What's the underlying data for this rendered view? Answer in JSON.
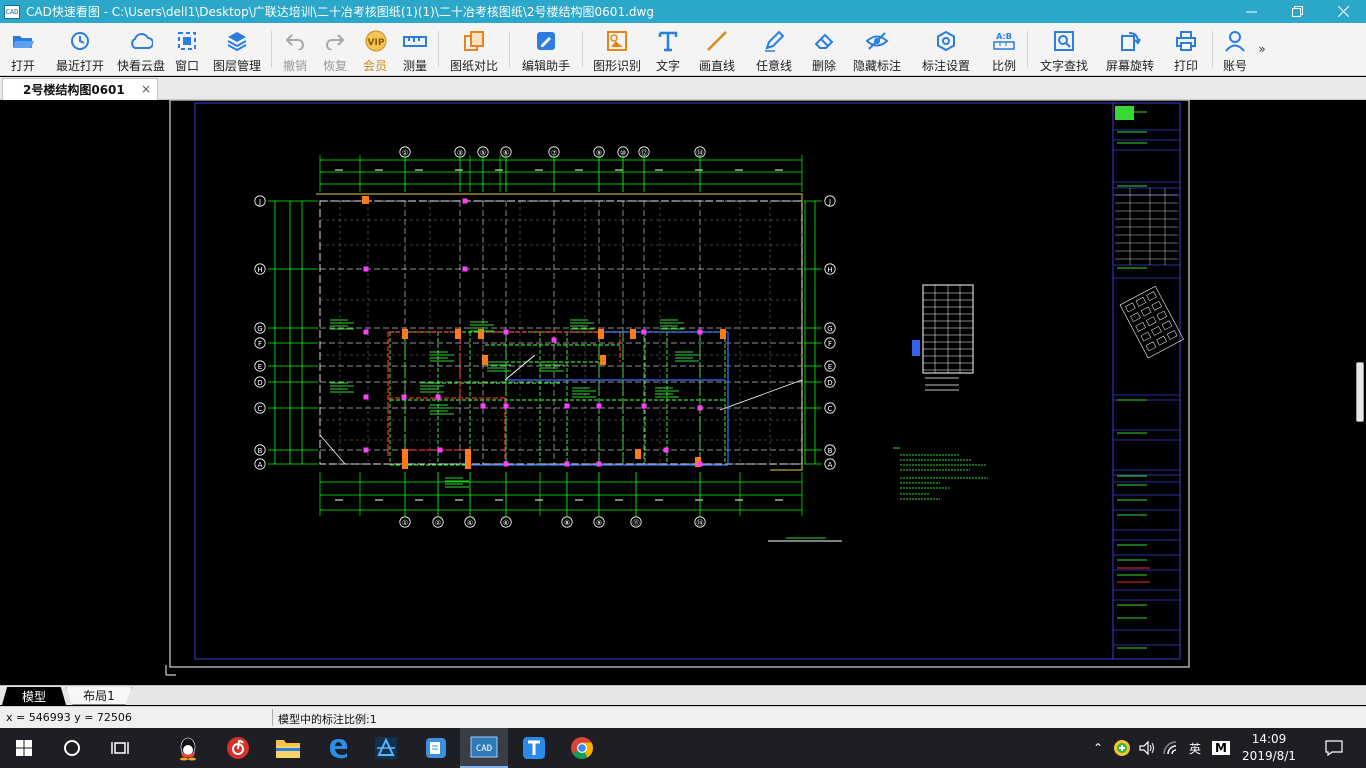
{
  "window": {
    "title": "CAD快速看图 - C:\\Users\\dell1\\Desktop\\广联达培训\\二十冶考核图纸(1)(1)\\二十冶考核图纸\\2号楼结构图0601.dwg",
    "app_icon_text": "CAD"
  },
  "toolbar": {
    "open": "打开",
    "recent": "最近打开",
    "cloud": "快看云盘",
    "window": "窗口",
    "layers": "图层管理",
    "undo": "撤销",
    "redo": "恢复",
    "vip": "会员",
    "measure": "测量",
    "compare": "图纸对比",
    "edit_helper": "编辑助手",
    "shape_recog": "图形识别",
    "text": "文字",
    "line": "画直线",
    "freeline": "任意线",
    "delete": "删除",
    "hide_dim": "隐藏标注",
    "dim_settings": "标注设置",
    "scale": "比例",
    "text_search": "文字查找",
    "rotate": "屏幕旋转",
    "print": "打印",
    "account": "账号",
    "vip_badge": "VIP",
    "scale_badge": "A:B"
  },
  "tabs": {
    "document": "2号楼结构图0601",
    "close": "×"
  },
  "layout_tabs": {
    "model": "模型",
    "layout1": "布局1"
  },
  "statusbar": {
    "coords": "x = 546993  y = 72506",
    "dim_scale": "模型中的标注比例:1"
  },
  "taskbar": {
    "ime_lang": "英",
    "ime_mode": "M",
    "time": "14:09",
    "date": "2019/8/1"
  },
  "drawing": {
    "top_axis_labels": [
      "①",
      "③",
      "⑤",
      "⑥",
      "⑦",
      "⑨",
      "⑩",
      "⑫",
      "⑭"
    ],
    "bottom_axis_labels": [
      "①",
      "②",
      "④",
      "⑥",
      "⑧",
      "⑨",
      "⑪",
      "⑭"
    ],
    "side_axis_labels": [
      "J",
      "H",
      "G",
      "F",
      "E",
      "D",
      "C",
      "B",
      "A"
    ],
    "colors": {
      "border": "#3b3bd6",
      "frame": "#ffffff",
      "grid": "#ffffff",
      "dim": "#00ff00",
      "wall_green": "#35d835",
      "wall_red": "#e63030",
      "beam_blue": "#3a70ff",
      "column_orange": "#ff7a1a",
      "column_magenta": "#ff40ff",
      "outline_yellow": "#e0d040"
    }
  }
}
